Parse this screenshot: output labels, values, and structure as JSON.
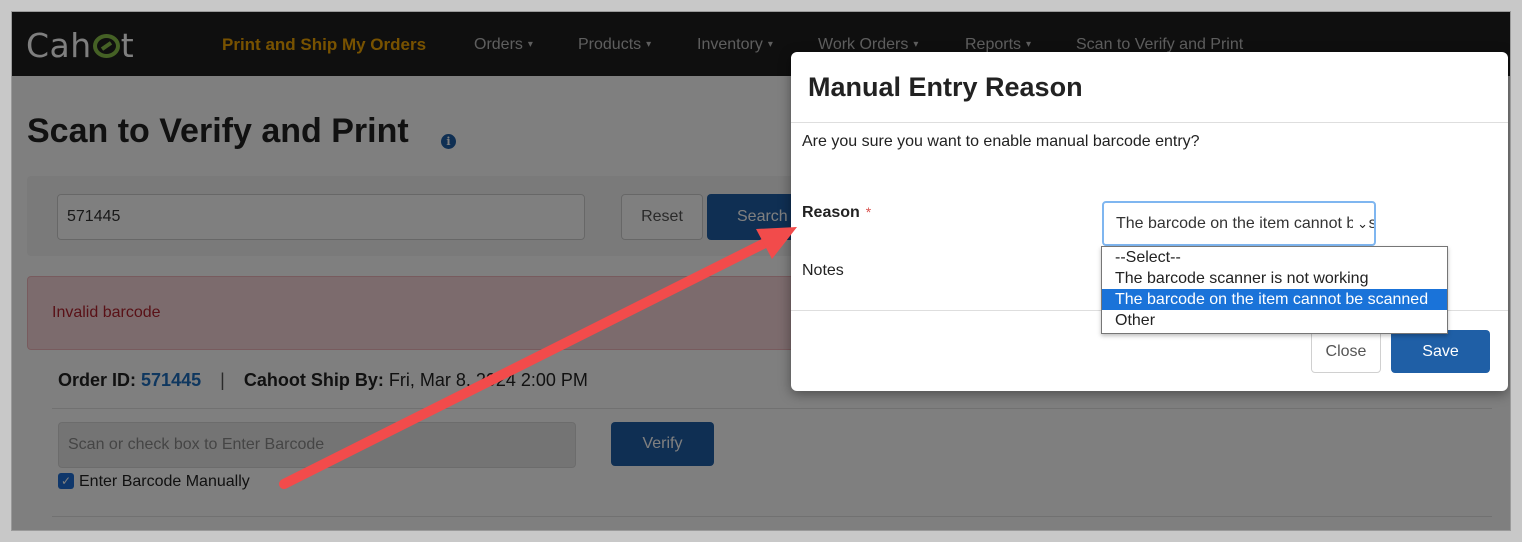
{
  "nav": {
    "logo": "Cahoot",
    "items": [
      {
        "label": "Print and Ship My Orders",
        "active": true,
        "dropdown": false
      },
      {
        "label": "Orders",
        "dropdown": true
      },
      {
        "label": "Products",
        "dropdown": true
      },
      {
        "label": "Inventory",
        "dropdown": true
      },
      {
        "label": "Work Orders",
        "dropdown": true
      },
      {
        "label": "Reports",
        "dropdown": true
      },
      {
        "label": "Scan to Verify and Print",
        "dropdown": false
      }
    ],
    "caret": "▾"
  },
  "page": {
    "title": "Scan to Verify and Print",
    "info_icon": "i",
    "search": {
      "value": "571445",
      "reset_label": "Reset",
      "search_label": "Search"
    },
    "alert": "Invalid barcode",
    "order": {
      "order_id_label": "Order ID:",
      "order_id": "571445",
      "separator": "|",
      "ship_by_label": "Cahoot Ship By:",
      "ship_by_value": "Fri, Mar 8, 2024 2:00 PM"
    },
    "scan": {
      "placeholder": "Scan or check box to Enter Barcode",
      "verify_label": "Verify"
    },
    "manual_checkbox": {
      "label": "Enter Barcode Manually",
      "checked": true
    }
  },
  "modal": {
    "title": "Manual Entry Reason",
    "question": "Are you sure you want to enable manual barcode entry?",
    "reason_label": "Reason",
    "required_mark": "*",
    "notes_label": "Notes",
    "select_value": "The barcode on the item cannot be scanned",
    "select_arrow": "⌄",
    "options": [
      "--Select--",
      "The barcode scanner is not working",
      "The barcode on the item cannot be scanned",
      "Other"
    ],
    "selected_index": 2,
    "close_label": "Close",
    "save_label": "Save"
  },
  "colors": {
    "nav_bg": "#1f1f1f",
    "active_nav": "#f0a500",
    "primary": "#1f5fa6",
    "alert_bg": "#f8d7da",
    "annotation_arrow": "#f24b4b"
  }
}
